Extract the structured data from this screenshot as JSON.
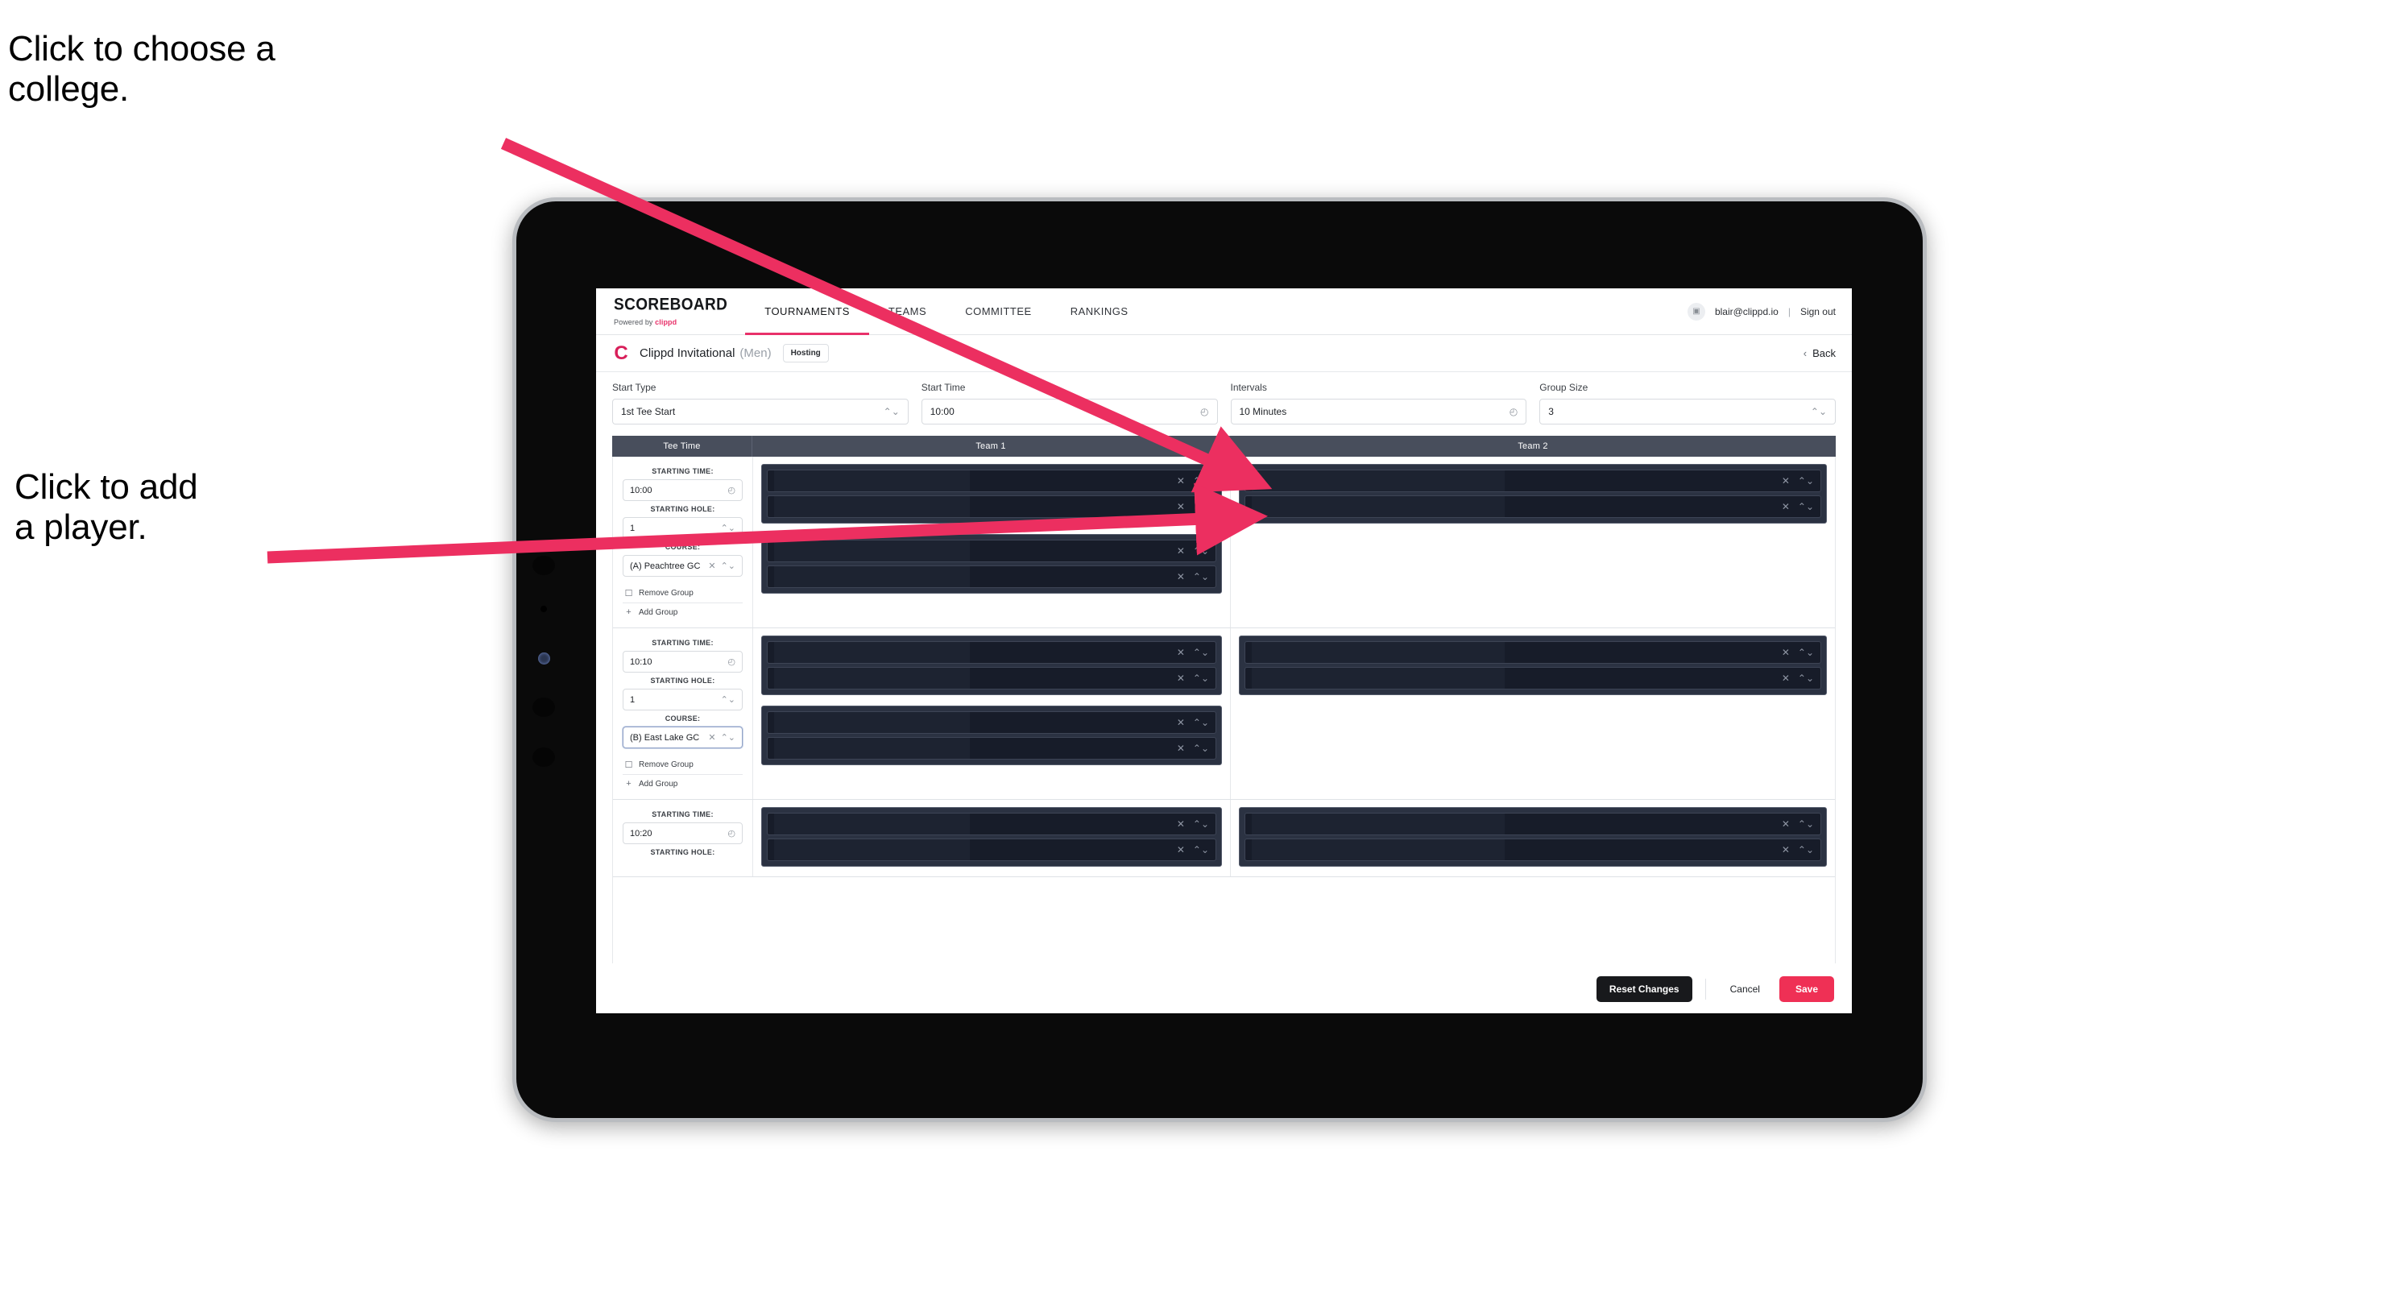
{
  "annotations": {
    "choose_college": "Click to choose a\ncollege.",
    "add_player": "Click to add\na player."
  },
  "colors": {
    "accent_pink": "#e8316a",
    "arrow_pink": "#ec2f60",
    "save_red": "#ef3055",
    "table_header": "#484e5c",
    "slot_dark": "#171c29",
    "group_box": "#2b3242"
  },
  "nav": {
    "brand_title": "SCOREBOARD",
    "brand_sub_prefix": "Powered by ",
    "brand_sub_name": "clippd",
    "tabs": [
      {
        "label": "TOURNAMENTS",
        "active": true
      },
      {
        "label": "TEAMS",
        "active": false
      },
      {
        "label": "COMMITTEE",
        "active": false
      },
      {
        "label": "RANKINGS",
        "active": false
      }
    ],
    "avatar_glyph": "▣",
    "user_email": "blair@clippd.io",
    "separator": "|",
    "sign_out": "Sign out"
  },
  "tournament_bar": {
    "logo_letter": "C",
    "name": "Clippd Invitational",
    "gender": "(Men)",
    "role_badge": "Hosting",
    "back_chevron": "‹",
    "back_label": "Back"
  },
  "controls": [
    {
      "label": "Start Type",
      "value": "1st Tee Start",
      "icon": "stepper-icon",
      "glyph": "⌃⌄"
    },
    {
      "label": "Start Time",
      "value": "10:00",
      "icon": "clock-icon",
      "glyph": "◴"
    },
    {
      "label": "Intervals",
      "value": "10 Minutes",
      "icon": "clock-icon",
      "glyph": "◴"
    },
    {
      "label": "Group Size",
      "value": "3",
      "icon": "stepper-icon",
      "glyph": "⌃⌄"
    }
  ],
  "table": {
    "headers": {
      "tee_time": "Tee Time",
      "team1": "Team 1",
      "team2": "Team 2"
    },
    "labels": {
      "starting_time": "STARTING TIME:",
      "starting_hole": "STARTING HOLE:",
      "course": "COURSE:",
      "remove_group": "Remove Group",
      "add_group": "Add Group"
    },
    "icons": {
      "clock": "◴",
      "stepper": "⌃⌄",
      "clear": "✕",
      "trash": "☐",
      "plus": "+"
    },
    "rows": [
      {
        "starting_time": "10:00",
        "starting_hole": "1",
        "course": "(A) Peachtree GC",
        "course_focused": false,
        "team1_groups": [
          {
            "slots": [
              "",
              ""
            ]
          },
          {
            "slots": [
              "",
              ""
            ]
          }
        ],
        "team2_groups": [
          {
            "slots": [
              "",
              ""
            ]
          }
        ]
      },
      {
        "starting_time": "10:10",
        "starting_hole": "1",
        "course": "(B) East Lake GC",
        "course_focused": true,
        "team1_groups": [
          {
            "slots": [
              "",
              ""
            ]
          },
          {
            "slots": [
              "",
              ""
            ]
          }
        ],
        "team2_groups": [
          {
            "slots": [
              "",
              ""
            ]
          }
        ]
      },
      {
        "starting_time": "10:20",
        "starting_hole": "",
        "course": "",
        "course_focused": false,
        "team1_groups": [
          {
            "slots": [
              "",
              ""
            ]
          }
        ],
        "team2_groups": [
          {
            "slots": [
              "",
              ""
            ]
          }
        ]
      }
    ]
  },
  "footer": {
    "reset_label": "Reset Changes",
    "cancel_label": "Cancel",
    "save_label": "Save"
  }
}
